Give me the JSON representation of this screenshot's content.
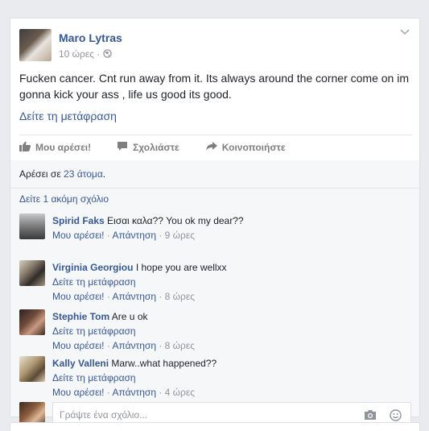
{
  "post": {
    "author": "Maro Lytras",
    "time": "10 ώρες",
    "meta_sep": "·",
    "text": "Fucken cancer. Cnt run away from it. Its always around the corner come on im gonna kick your ass , life us good its good.",
    "see_translation": "Δείτε τη μετάφραση"
  },
  "actions": {
    "like": "Μου αρέσει!",
    "comment": "Σχολιάστε",
    "share": "Κοινοποιήστε"
  },
  "likes": {
    "prefix": "Αρέσει σε",
    "link": "23 άτομα",
    "suffix": "."
  },
  "more_comments": "Δείτε 1 ακόμη σχόλιο",
  "comments": [
    {
      "name": "Spirid Faks",
      "text": "Εισαι καλα?? You ok my dear??",
      "translation": "",
      "like": "Μου αρέσει!",
      "reply": "Απάντηση",
      "time": "9 ώρες"
    },
    {
      "name": "Virginia Georgiou",
      "text": "I hope you are wellxx",
      "translation": "Δείτε τη μετάφραση",
      "like": "Μου αρέσει!",
      "reply": "Απάντηση",
      "time": "8 ώρες"
    },
    {
      "name": "Stephie Tom",
      "text": "Are u ok",
      "translation": "Δείτε τη μετάφραση",
      "like": "Μου αρέσει!",
      "reply": "Απάντηση",
      "time": "8 ώρες"
    },
    {
      "name": "Kally Valleni",
      "text": "Marw..what happened??",
      "translation": "Δείτε τη μετάφραση",
      "like": "Μου αρέσει!",
      "reply": "Απάντηση",
      "time": "4 ώρες"
    }
  ],
  "composer": {
    "placeholder": "Γράψτε ένα σχόλιο..."
  },
  "icons": {
    "globe": "globe-icon",
    "chevron": "chevron-down-icon",
    "like": "thumbs-up-icon",
    "comment": "speech-bubble-icon",
    "share": "share-arrow-icon",
    "camera": "camera-icon",
    "emoji": "smiley-icon"
  },
  "colors": {
    "link": "#365899",
    "meta": "#90949c",
    "lower_bg": "#f6f7f9"
  }
}
